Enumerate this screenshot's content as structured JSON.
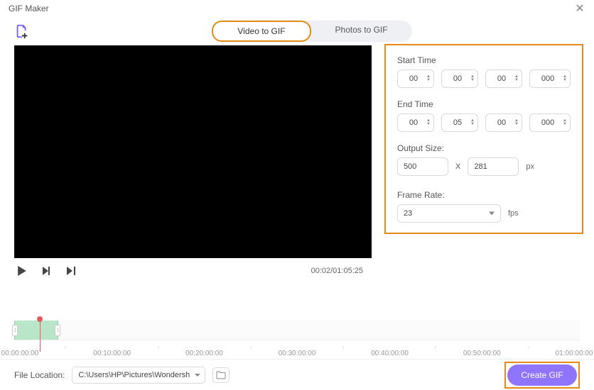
{
  "window": {
    "title": "GIF Maker"
  },
  "tabs": {
    "video": "Video to GIF",
    "photos": "Photos to GIF"
  },
  "settings": {
    "start_label": "Start Time",
    "end_label": "End Time",
    "start": {
      "h": "00",
      "m": "00",
      "s": "00",
      "ms": "000"
    },
    "end": {
      "h": "00",
      "m": "05",
      "s": "00",
      "ms": "000"
    },
    "size_label": "Output Size:",
    "width": "500",
    "height": "281",
    "size_unit": "px",
    "fr_label": "Frame Rate:",
    "fr_value": "23",
    "fr_unit": "fps"
  },
  "player": {
    "time": "00:02/01:05:25"
  },
  "timeline": {
    "ticks": [
      "00:00:00:00",
      "00:10:00:00",
      "00:20:00:00",
      "00:30:00:00",
      "00:40:00:00",
      "00:50:00:00",
      "01:00:00:00"
    ]
  },
  "footer": {
    "label": "File Location:",
    "path": "C:\\Users\\HP\\Pictures\\Wondersh",
    "create": "Create GIF"
  }
}
